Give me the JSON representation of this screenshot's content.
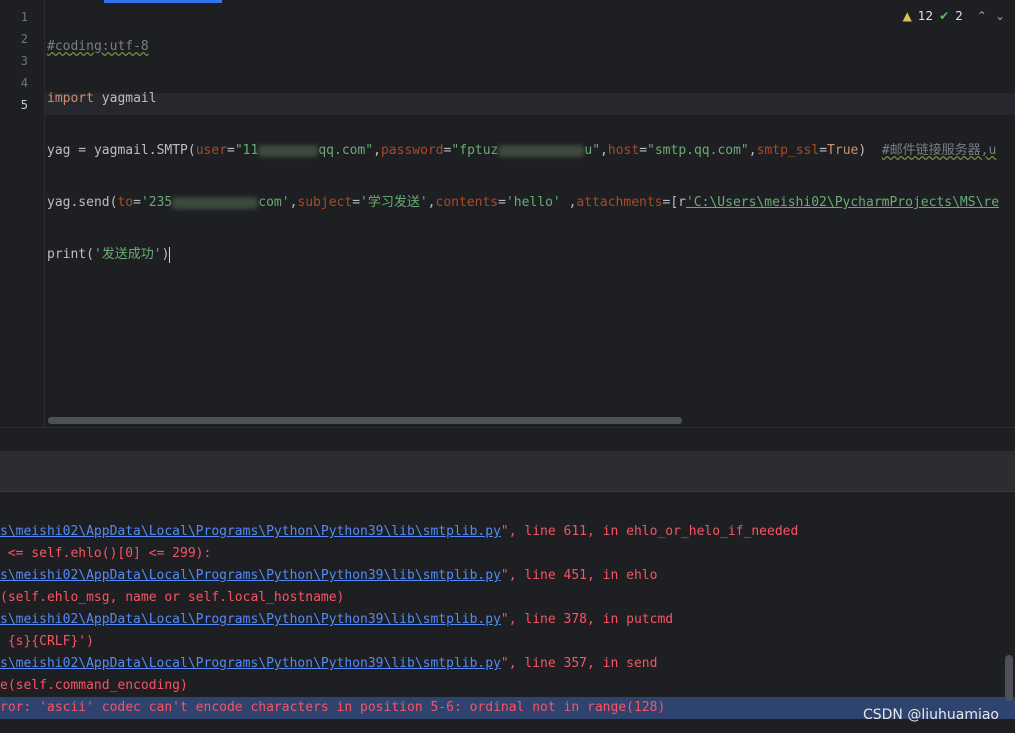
{
  "editor": {
    "line_numbers": [
      "1",
      "2",
      "3",
      "4",
      "5"
    ],
    "line1": "#coding:utf-8",
    "line2": {
      "kw": "import",
      "rest": " yagmail"
    },
    "line3": {
      "a": "yag = yagmail.SMTP(",
      "user_key": "user",
      "eq": "=",
      "user_val_a": "\"11",
      "user_val_b": "qq.com\"",
      "pwd_key": "password",
      "pwd_val_a": "\"fptuz",
      "pwd_val_b": "u\"",
      "host_key": "host",
      "host_val": "\"smtp.qq.com\"",
      "ssl_key": "smtp_ssl",
      "ssl_val": "True",
      "close": ")  ",
      "comment": "#邮件链接服务器,u"
    },
    "line4": {
      "a": "yag.send(",
      "to_key": "to",
      "to_val_a": "'235",
      "to_val_b": "com'",
      "subj_key": "subject",
      "subj_val": "'学习发送'",
      "cont_key": "contents",
      "cont_val": "'hello' ",
      "att_key": "attachments",
      "att_open": "=[r",
      "att_val": "'C:\\Users\\meishi02\\PycharmProjects\\MS\\re"
    },
    "line5": {
      "fn": "print(",
      "str": "'发送成功'",
      "close": ")"
    }
  },
  "inspections": {
    "warnings": "12",
    "weak_warnings": "2"
  },
  "console": {
    "lines": [
      {
        "path": "s\\meishi02\\AppData\\Local\\Programs\\Python\\Python39\\lib\\smtplib.py",
        "rest": "\", line 611, in ehlo_or_helo_if_needed"
      },
      {
        "path": "",
        "rest": " <= self.ehlo()[0] <= 299):"
      },
      {
        "path": "s\\meishi02\\AppData\\Local\\Programs\\Python\\Python39\\lib\\smtplib.py",
        "rest": "\", line 451, in ehlo"
      },
      {
        "path": "",
        "rest": "(self.ehlo_msg, name or self.local_hostname)"
      },
      {
        "path": "s\\meishi02\\AppData\\Local\\Programs\\Python\\Python39\\lib\\smtplib.py",
        "rest": "\", line 378, in putcmd"
      },
      {
        "path": "",
        "rest": " {s}{CRLF}')"
      },
      {
        "path": "s\\meishi02\\AppData\\Local\\Programs\\Python\\Python39\\lib\\smtplib.py",
        "rest": "\", line 357, in send"
      },
      {
        "path": "",
        "rest": "e(self.command_encoding)"
      },
      {
        "path": "",
        "rest": "ror: 'ascii' codec can't encode characters in position 5-6: ordinal not in range(128)"
      }
    ]
  },
  "watermark": "CSDN @liuhuamiao"
}
